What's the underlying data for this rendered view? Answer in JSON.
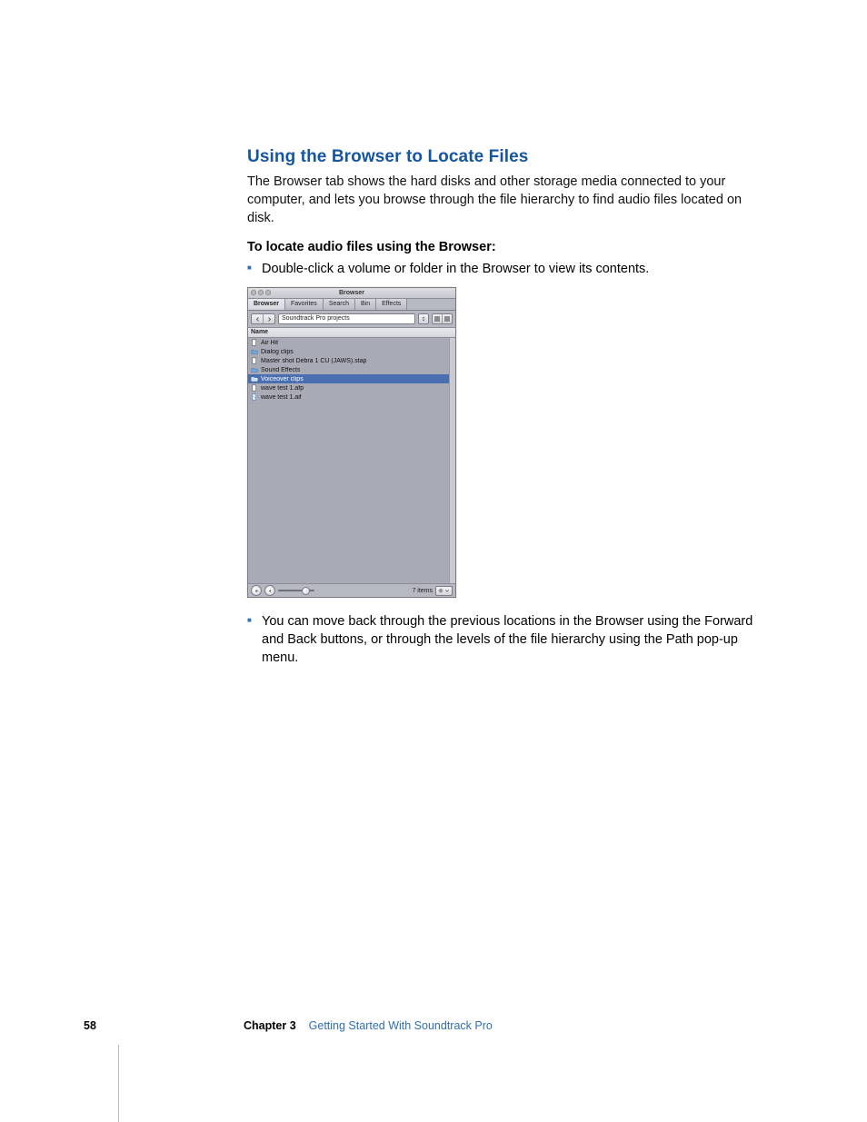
{
  "heading": "Using the Browser to Locate Files",
  "intro": "The Browser tab shows the hard disks and other storage media connected to your computer, and lets you browse through the file hierarchy to find audio files located on disk.",
  "subheading": "To locate audio files using the Browser:",
  "bullet1": "Double-click a volume or folder in the Browser to view its contents.",
  "bullet2": "You can move back through the previous locations in the Browser using the Forward and Back buttons, or through the levels of the file hierarchy using the Path pop-up menu.",
  "panel": {
    "window_title": "Browser",
    "tabs": [
      "Browser",
      "Favorites",
      "Search",
      "Bin",
      "Effects"
    ],
    "active_tab": 0,
    "path": "Soundtrack Pro projects",
    "list_header": "Name",
    "items": [
      {
        "label": "Air Hit",
        "type": "file"
      },
      {
        "label": "Dialog clips",
        "type": "folder"
      },
      {
        "label": "Master shot Debra 1 CU (JAWS).stap",
        "type": "file"
      },
      {
        "label": "Sound Effects",
        "type": "folder"
      },
      {
        "label": "Voiceover clips",
        "type": "folder",
        "selected": true
      },
      {
        "label": "wave test 1.afp",
        "type": "file"
      },
      {
        "label": "wave test 1.aif",
        "type": "audio"
      }
    ],
    "item_count_label": "7 items"
  },
  "footer": {
    "page_number": "58",
    "chapter_label": "Chapter 3",
    "chapter_title": "Getting Started With Soundtrack Pro"
  }
}
